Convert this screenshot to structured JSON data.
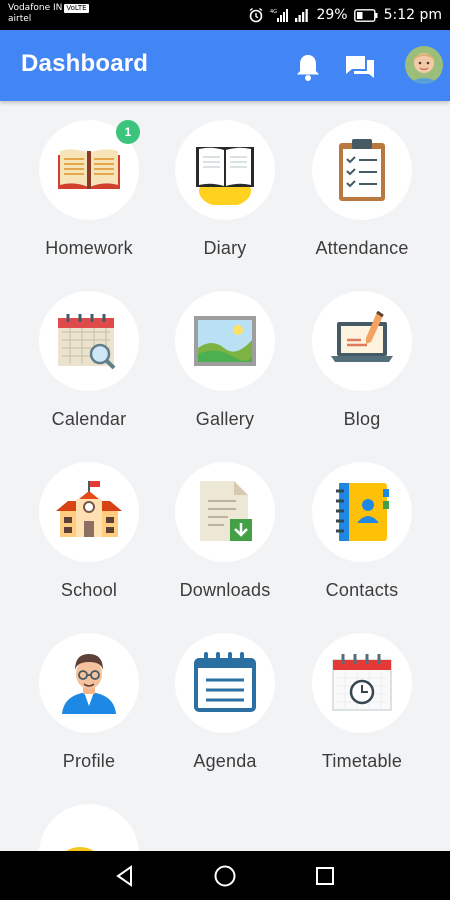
{
  "status_bar": {
    "carrier_primary": "Vodafone IN",
    "volte": "VoLTE",
    "carrier_secondary": "airtel",
    "battery": "29%",
    "time": "5:12 pm"
  },
  "header": {
    "title": "Dashboard"
  },
  "menu": [
    {
      "label": "Homework",
      "badge": "1"
    },
    {
      "label": "Diary"
    },
    {
      "label": "Attendance"
    },
    {
      "label": "Calendar"
    },
    {
      "label": "Gallery"
    },
    {
      "label": "Blog"
    },
    {
      "label": "School"
    },
    {
      "label": "Downloads"
    },
    {
      "label": "Contacts"
    },
    {
      "label": "Profile"
    },
    {
      "label": "Agenda"
    },
    {
      "label": "Timetable"
    },
    {
      "label": ""
    }
  ],
  "colors": {
    "app_bar": "#4285f4",
    "background": "#f2f3f5",
    "badge": "#3cc47c"
  }
}
